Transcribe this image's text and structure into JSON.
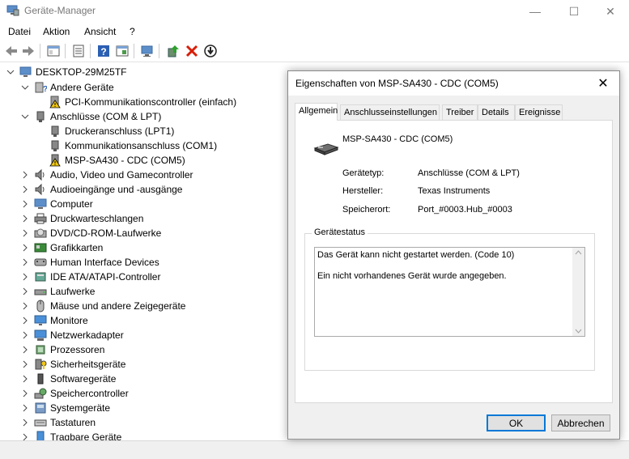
{
  "window": {
    "title": "Geräte-Manager",
    "controls": {
      "minimize": "—",
      "maximize": "☐",
      "close": "✕"
    }
  },
  "menu": [
    "Datei",
    "Aktion",
    "Ansicht",
    "?"
  ],
  "tree": {
    "root": "DESKTOP-29M25TF",
    "items": [
      {
        "label": "Andere Geräte",
        "icon": "unknown-device-icon"
      },
      {
        "label": "PCI-Kommunikationscontroller (einfach)",
        "icon": "warning-device-icon"
      },
      {
        "label": "Anschlüsse (COM & LPT)",
        "icon": "port-icon"
      },
      {
        "label": "Druckeranschluss (LPT1)",
        "icon": "port-icon"
      },
      {
        "label": "Kommunikationsanschluss (COM1)",
        "icon": "port-icon"
      },
      {
        "label": "MSP-SA430 - CDC (COM5)",
        "icon": "warning-port-icon"
      },
      {
        "label": "Audio, Video und Gamecontroller",
        "icon": "speaker-icon"
      },
      {
        "label": "Audioeingänge und -ausgänge",
        "icon": "speaker-icon"
      },
      {
        "label": "Computer",
        "icon": "computer-icon"
      },
      {
        "label": "Druckwarteschlangen",
        "icon": "printer-icon"
      },
      {
        "label": "DVD/CD-ROM-Laufwerke",
        "icon": "disc-drive-icon"
      },
      {
        "label": "Grafikkarten",
        "icon": "display-adapter-icon"
      },
      {
        "label": "Human Interface Devices",
        "icon": "hid-icon"
      },
      {
        "label": "IDE ATA/ATAPI-Controller",
        "icon": "ide-controller-icon"
      },
      {
        "label": "Laufwerke",
        "icon": "disk-drive-icon"
      },
      {
        "label": "Mäuse und andere Zeigegeräte",
        "icon": "mouse-icon"
      },
      {
        "label": "Monitore",
        "icon": "monitor-icon"
      },
      {
        "label": "Netzwerkadapter",
        "icon": "network-adapter-icon"
      },
      {
        "label": "Prozessoren",
        "icon": "processor-icon"
      },
      {
        "label": "Sicherheitsgeräte",
        "icon": "security-device-icon"
      },
      {
        "label": "Softwaregeräte",
        "icon": "software-device-icon"
      },
      {
        "label": "Speichercontroller",
        "icon": "storage-controller-icon"
      },
      {
        "label": "Systemgeräte",
        "icon": "system-device-icon"
      },
      {
        "label": "Tastaturen",
        "icon": "keyboard-icon"
      },
      {
        "label": "Tragbare Geräte",
        "icon": "portable-device-icon"
      }
    ]
  },
  "dialog": {
    "title": "Eigenschaften von MSP-SA430 - CDC (COM5)",
    "close": "✕",
    "tabs": [
      "Allgemein",
      "Anschlusseinstellungen",
      "Treiber",
      "Details",
      "Ereignisse"
    ],
    "device_name": "MSP-SA430 - CDC (COM5)",
    "properties": [
      {
        "label": "Gerätetyp:",
        "value": "Anschlüsse (COM & LPT)"
      },
      {
        "label": "Hersteller:",
        "value": "Texas Instruments"
      },
      {
        "label": "Speicherort:",
        "value": "Port_#0003.Hub_#0003"
      }
    ],
    "status_legend": "Gerätestatus",
    "status_lines": [
      "Das Gerät kann nicht gestartet werden. (Code 10)",
      "Ein nicht vorhandenes Gerät wurde angegeben."
    ],
    "ok": "OK",
    "cancel": "Abbrechen"
  },
  "colors": {
    "accent": "#0078d7",
    "error_red": "#d81e06",
    "warning_yellow": "#f2c811"
  }
}
